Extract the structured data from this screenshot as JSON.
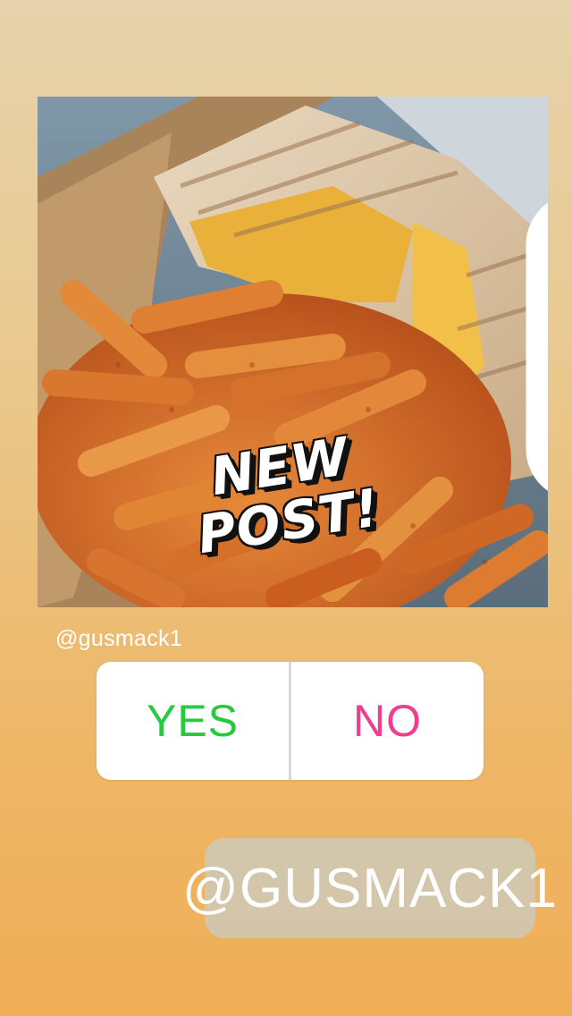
{
  "post": {
    "sticker_line1": "NEW",
    "sticker_line2": "POST!",
    "multi_icon": "carousel-icon"
  },
  "mention_small": "@gusmack1",
  "poll": {
    "yes_label": "YES",
    "no_label": "NO",
    "yes_color": "#27c93f",
    "no_color": "#f03d8e"
  },
  "mention_sticker": "@GUSMACK1",
  "colors": {
    "background_top": "#e6d2ac",
    "background_bottom": "#f0ae56"
  }
}
